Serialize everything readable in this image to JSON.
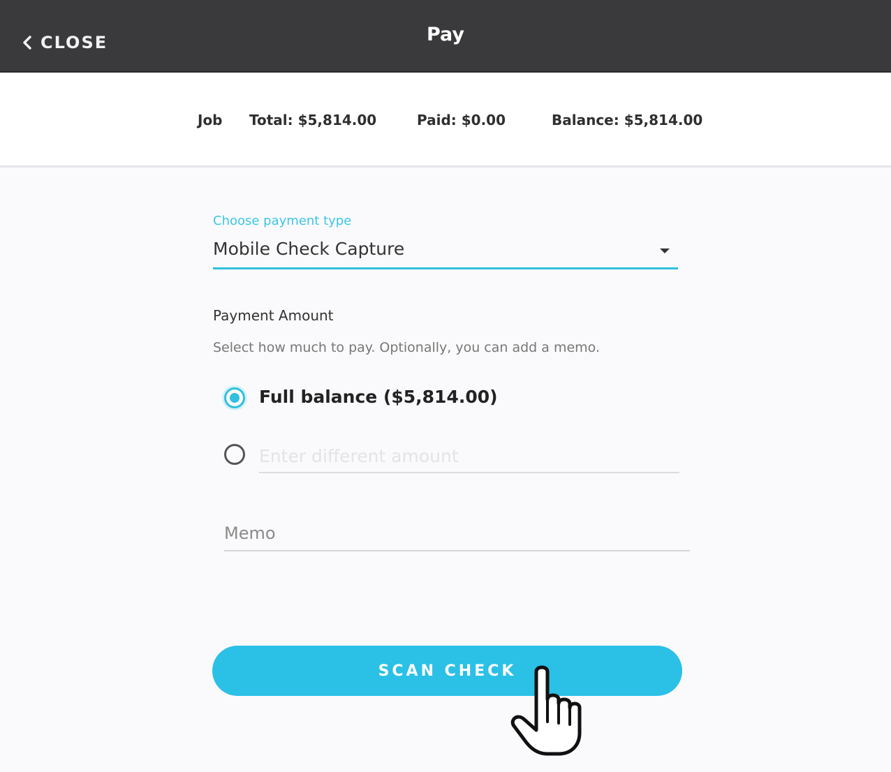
{
  "header": {
    "close_label": "CLOSE",
    "title": "Pay"
  },
  "summary": {
    "job_label": "Job",
    "total": "Total: $5,814.00",
    "paid": "Paid: $0.00",
    "balance": "Balance: $5,814.00"
  },
  "payment_type": {
    "label": "Choose payment type",
    "selected": "Mobile Check Capture"
  },
  "payment_amount": {
    "title": "Payment Amount",
    "description": "Select how much to pay. Optionally, you can add a memo.",
    "full_balance_label": "Full balance ($5,814.00)",
    "different_amount_placeholder": "Enter different amount",
    "selected_option": "full_balance"
  },
  "memo": {
    "placeholder": "Memo"
  },
  "actions": {
    "scan_label": "SCAN CHECK"
  },
  "icons": {
    "back": "chevron-left-icon",
    "dropdown": "caret-down-icon",
    "pointer": "hand-pointer-cursor"
  },
  "colors": {
    "header_bg": "#3a393b",
    "accent": "#2bc0e6",
    "page_bg": "#fafafc"
  }
}
